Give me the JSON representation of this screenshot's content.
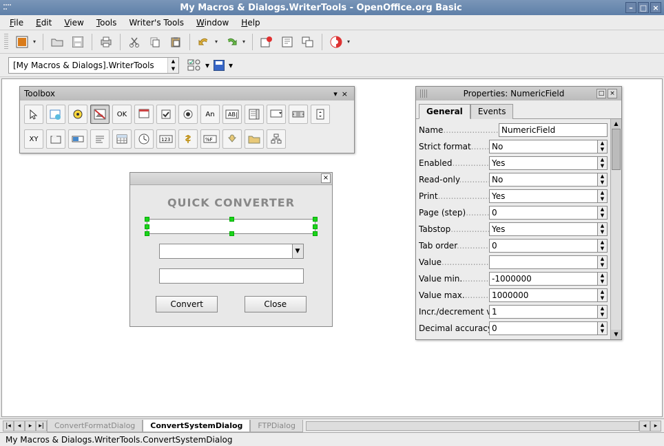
{
  "window": {
    "title": "My Macros & Dialogs.WriterTools - OpenOffice.org Basic"
  },
  "menus": [
    {
      "label": "File",
      "accel": "F"
    },
    {
      "label": "Edit",
      "accel": "E"
    },
    {
      "label": "View",
      "accel": "V"
    },
    {
      "label": "Tools",
      "accel": "T"
    },
    {
      "label": "Writer's Tools",
      "accel": ""
    },
    {
      "label": "Window",
      "accel": "W"
    },
    {
      "label": "Help",
      "accel": "H"
    }
  ],
  "library_combo": "[My Macros & Dialogs].WriterTools",
  "toolbox": {
    "title": "Toolbox",
    "tools_row1": [
      "select",
      "insert-controls",
      "wizard",
      "image-control",
      "ok-btn",
      "dialog-test",
      "checkbox",
      "radio",
      "label-aa",
      "textbox-ab",
      "listbox",
      "combo",
      "scrollbar",
      "spin"
    ],
    "tools_row2": [
      "xy-frame",
      "frame",
      "progress",
      "lines",
      "table",
      "time",
      "numeric",
      "currency",
      "percent",
      "push",
      "folder",
      "tree"
    ]
  },
  "dialog": {
    "heading": "QUICK CONVERTER",
    "buttons": {
      "convert": "Convert",
      "close": "Close"
    }
  },
  "properties": {
    "title": "Properties: NumericField",
    "tabs": {
      "general": "General",
      "events": "Events"
    },
    "rows": [
      {
        "label": "Name",
        "value": "NumericField",
        "spin": false
      },
      {
        "label": "Strict format",
        "value": "No",
        "spin": true
      },
      {
        "label": "Enabled",
        "value": "Yes",
        "spin": true
      },
      {
        "label": "Read-only",
        "value": "No",
        "spin": true
      },
      {
        "label": "Print",
        "value": "Yes",
        "spin": true
      },
      {
        "label": "Page (step)",
        "value": "0",
        "spin": true
      },
      {
        "label": "Tabstop",
        "value": "Yes",
        "spin": true
      },
      {
        "label": "Tab order",
        "value": "0",
        "spin": true
      },
      {
        "label": "Value",
        "value": "",
        "spin": true
      },
      {
        "label": "Value min.",
        "value": "-1000000",
        "spin": true
      },
      {
        "label": "Value max.",
        "value": "1000000",
        "spin": true
      },
      {
        "label": "Incr./decrement value",
        "value": "1",
        "spin": true
      },
      {
        "label": "Decimal accuracy",
        "value": "0",
        "spin": true
      }
    ]
  },
  "bottom_tabs": [
    "ConvertFormatDialog",
    "ConvertSystemDialog",
    "FTPDialog"
  ],
  "bottom_active": 1,
  "status": "My Macros & Dialogs.WriterTools.ConvertSystemDialog"
}
